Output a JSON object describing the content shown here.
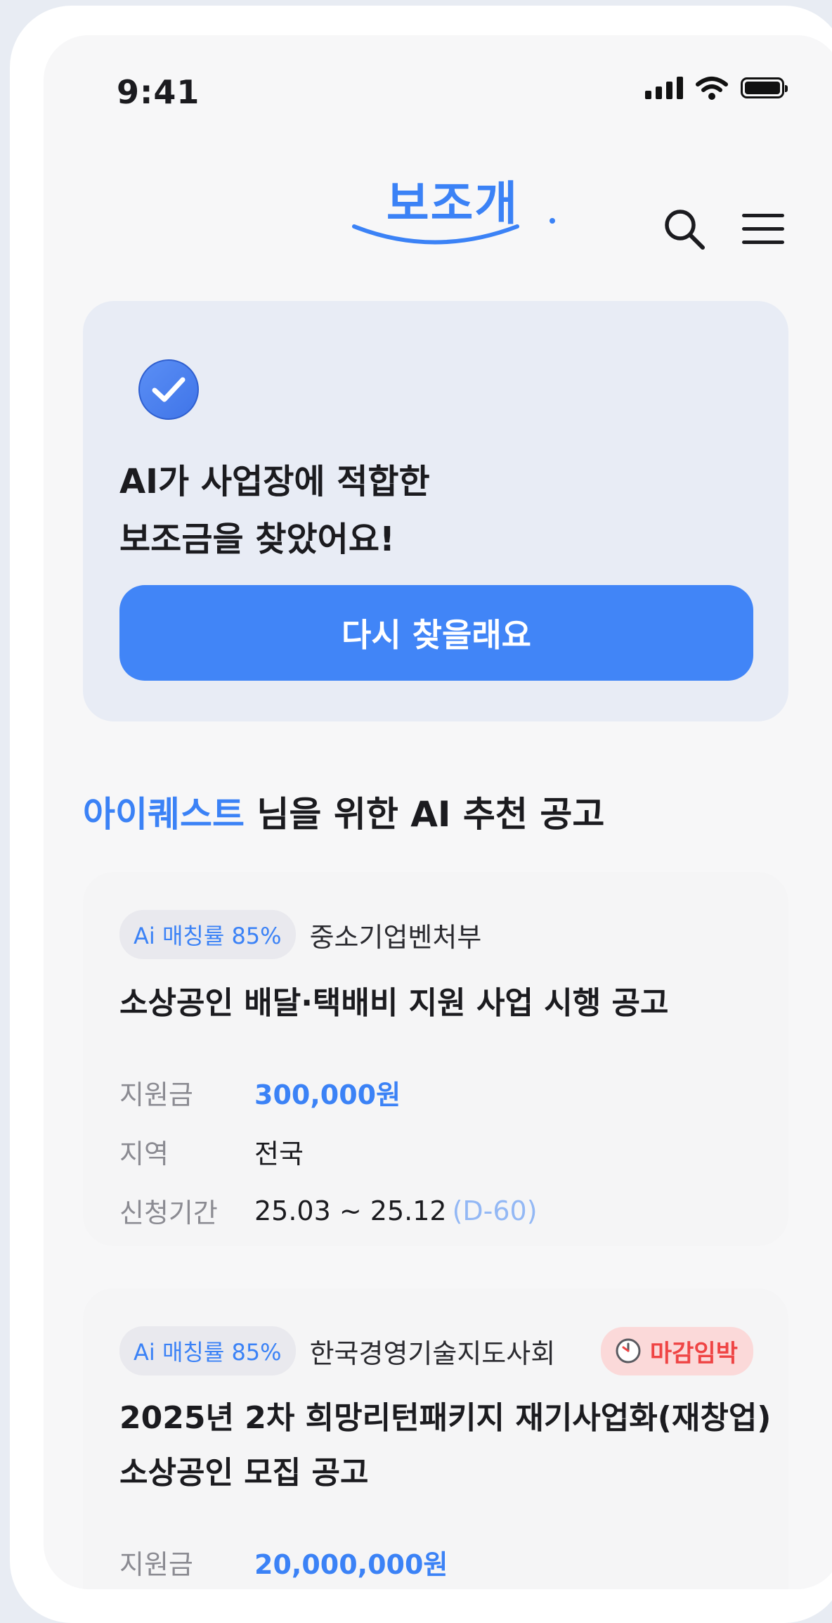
{
  "status_bar": {
    "time": "9:41"
  },
  "header": {
    "logo_text": "보조개"
  },
  "hero": {
    "title_line1": "AI가 사업장에 적합한",
    "title_line2": "보조금을 찾았어요!",
    "retry_label": "다시 찾을래요"
  },
  "section": {
    "user_name": "아이퀘스트",
    "title_suffix": " 님을 위한 AI 추천 공고"
  },
  "labels": {
    "amount": "지원금",
    "region": "지역",
    "period": "신청기간"
  },
  "cards": [
    {
      "match": "Ai 매칭률 85%",
      "org": "중소기업벤처부",
      "title": "소상공인 배달·택배비 지원 사업 시행 공고",
      "amount": "300,000원",
      "region": "전국",
      "period": "25.03 ~ 25.12",
      "dday": "(D-60)"
    },
    {
      "match": "Ai 매칭률 85%",
      "org": "한국경영기술지도사회",
      "deadline_badge": "마감임박",
      "title_line1": "2025년 2차 희망리턴패키지 재기사업화(재창업)",
      "title_line2": "소상공인 모집 공고",
      "amount": "20,000,000원"
    }
  ],
  "colors": {
    "brand": "#3b82f6",
    "button": "#4185f7",
    "deadline": "#ef4444",
    "deadline_bg": "#fbd9d9"
  },
  "icons": [
    "signal-icon",
    "wifi-icon",
    "battery-icon",
    "search-icon",
    "menu-icon",
    "check-circle-icon",
    "clock-icon"
  ]
}
